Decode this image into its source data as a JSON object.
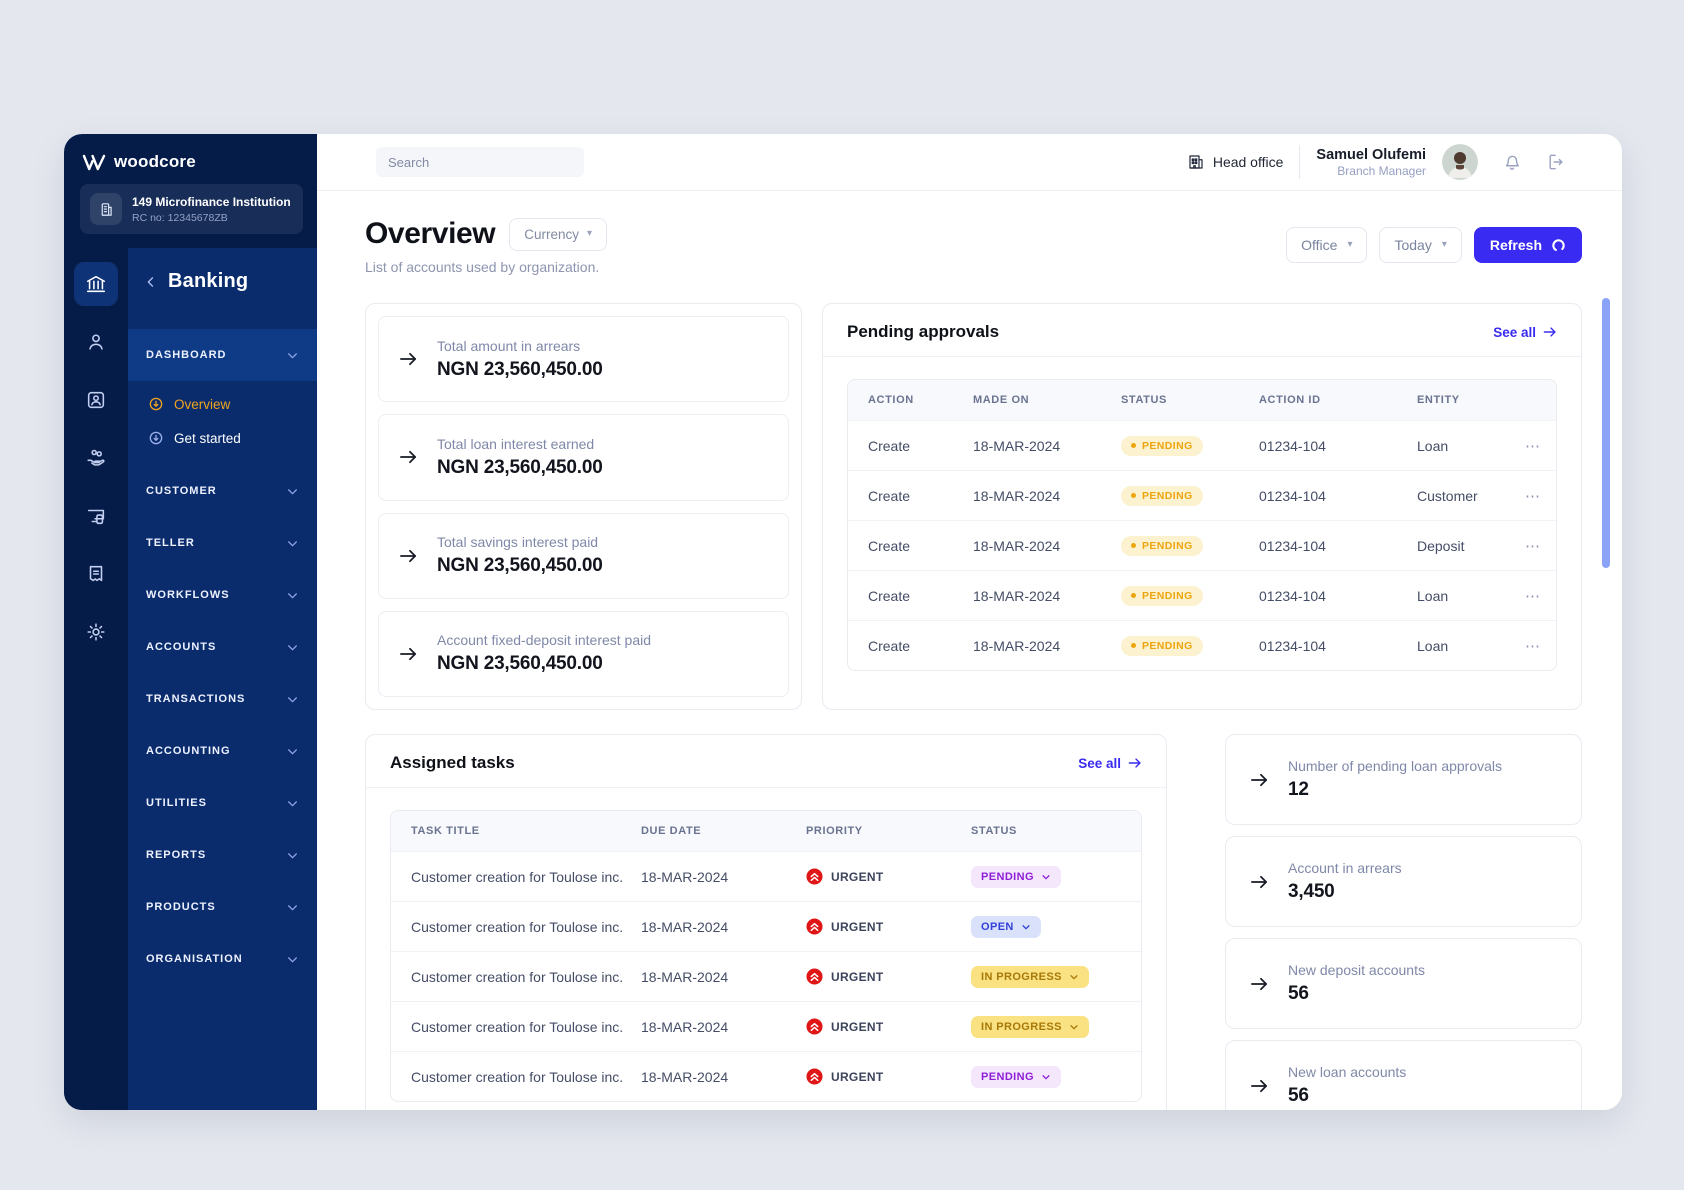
{
  "icons": {
    "ellipsis": "⋯",
    "caret": "▾"
  },
  "colors": {
    "accent": "#3a2bf2",
    "sidebar_rail": "#051c49",
    "sidebar_menu": "#0a2c6d",
    "pending_orange": "#eda50f",
    "urgent_red": "#e01616",
    "active_orange": "#f0a41c"
  },
  "sidebar": {
    "brand": "woodcore",
    "institution": {
      "name": "149 Microfinance Institution",
      "rc": "RC no: 12345678ZB"
    },
    "module": "Banking",
    "rail_icons": [
      "bank",
      "person",
      "id-card",
      "hand-coins",
      "devices",
      "receipt",
      "gear"
    ],
    "dashboard": {
      "label": "DASHBOARD",
      "items": [
        {
          "label": "Overview"
        },
        {
          "label": "Get started"
        }
      ]
    },
    "groups": [
      "CUSTOMER",
      "TELLER",
      "WORKFLOWS",
      "ACCOUNTS",
      "TRANSACTIONS",
      "ACCOUNTING",
      "UTILITIES",
      "REPORTS",
      "PRODUCTS",
      "ORGANISATION"
    ]
  },
  "topbar": {
    "search_placeholder": "Search",
    "office_label": "Head office",
    "user_name": "Samuel Olufemi",
    "user_role": "Branch Manager"
  },
  "header": {
    "title": "Overview",
    "currency_label": "Currency",
    "subtitle": "List of accounts used by organization.",
    "office_filter": "Office",
    "date_filter": "Today",
    "refresh_label": "Refresh"
  },
  "stats": [
    {
      "label": "Total amount in arrears",
      "value": "NGN 23,560,450.00"
    },
    {
      "label": "Total loan interest earned",
      "value": "NGN 23,560,450.00"
    },
    {
      "label": "Total savings interest paid",
      "value": "NGN 23,560,450.00"
    },
    {
      "label": "Account fixed-deposit interest paid",
      "value": "NGN 23,560,450.00"
    }
  ],
  "pending_approvals": {
    "title": "Pending approvals",
    "see_all": "See all",
    "columns": [
      "ACTION",
      "MADE ON",
      "STATUS",
      "ACTION ID",
      "ENTITY"
    ],
    "rows": [
      {
        "action": "Create",
        "made_on": "18-MAR-2024",
        "status": "PENDING",
        "action_id": "01234-104",
        "entity": "Loan"
      },
      {
        "action": "Create",
        "made_on": "18-MAR-2024",
        "status": "PENDING",
        "action_id": "01234-104",
        "entity": "Customer"
      },
      {
        "action": "Create",
        "made_on": "18-MAR-2024",
        "status": "PENDING",
        "action_id": "01234-104",
        "entity": "Deposit"
      },
      {
        "action": "Create",
        "made_on": "18-MAR-2024",
        "status": "PENDING",
        "action_id": "01234-104",
        "entity": "Loan"
      },
      {
        "action": "Create",
        "made_on": "18-MAR-2024",
        "status": "PENDING",
        "action_id": "01234-104",
        "entity": "Loan"
      }
    ]
  },
  "assigned_tasks": {
    "title": "Assigned tasks",
    "see_all": "See all",
    "columns": [
      "TASK TITLE",
      "DUE DATE",
      "PRIORITY",
      "STATUS"
    ],
    "rows": [
      {
        "title": "Customer creation for Toulose inc.",
        "due_date": "18-MAR-2024",
        "priority": "URGENT",
        "status": "PENDING"
      },
      {
        "title": "Customer creation for Toulose inc.",
        "due_date": "18-MAR-2024",
        "priority": "URGENT",
        "status": "OPEN"
      },
      {
        "title": "Customer creation for Toulose inc.",
        "due_date": "18-MAR-2024",
        "priority": "URGENT",
        "status": "IN PROGRESS"
      },
      {
        "title": "Customer creation for Toulose inc.",
        "due_date": "18-MAR-2024",
        "priority": "URGENT",
        "status": "IN PROGRESS"
      },
      {
        "title": "Customer creation for Toulose inc.",
        "due_date": "18-MAR-2024",
        "priority": "URGENT",
        "status": "PENDING"
      }
    ]
  },
  "summary_cards": [
    {
      "label": "Number of pending loan approvals",
      "value": "12"
    },
    {
      "label": "Account in arrears",
      "value": "3,450"
    },
    {
      "label": "New deposit accounts",
      "value": "56"
    },
    {
      "label": "New loan accounts",
      "value": "56"
    }
  ]
}
